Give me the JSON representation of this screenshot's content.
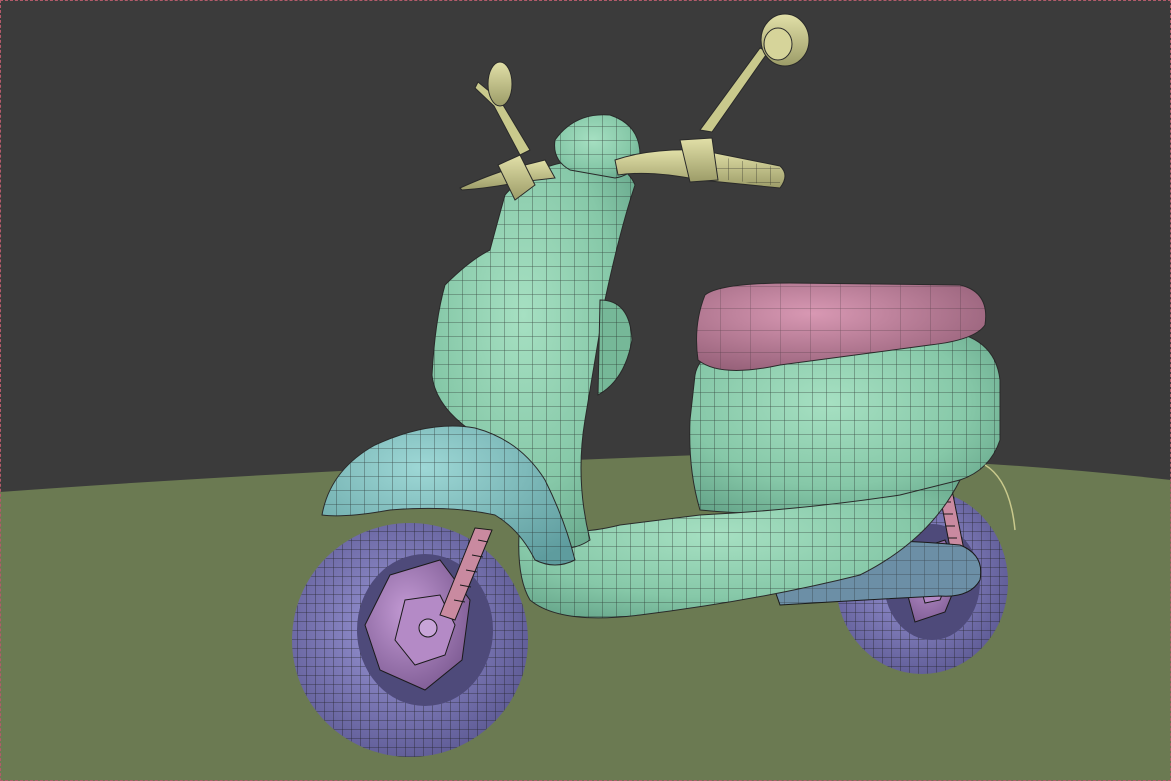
{
  "viewport": {
    "label": "",
    "colors": {
      "background": "#3b3b3b",
      "ground": "#6b7a52",
      "body_mesh": "#8fd1b0",
      "body_shadow": "#5f9e84",
      "fender_mesh": "#7fc0bf",
      "seat_mesh": "#c9849f",
      "seat_shadow": "#8e5a72",
      "tire_mesh": "#8a86c9",
      "rim_mesh": "#a07bb3",
      "handlebar_mesh": "#c9c98c",
      "fork_mesh": "#c98aa0",
      "wire": "#1a1a1a",
      "border": "#b35a6a"
    },
    "objects": [
      {
        "name": "scooter-body",
        "material": "body_mesh"
      },
      {
        "name": "front-fender",
        "material": "fender_mesh"
      },
      {
        "name": "seat",
        "material": "seat_mesh"
      },
      {
        "name": "front-wheel",
        "material": "tire_mesh"
      },
      {
        "name": "rear-wheel",
        "material": "tire_mesh"
      },
      {
        "name": "handlebar",
        "material": "handlebar_mesh"
      },
      {
        "name": "mirror-left",
        "material": "handlebar_mesh"
      },
      {
        "name": "mirror-right",
        "material": "handlebar_mesh"
      },
      {
        "name": "exhaust",
        "material": "body_mesh"
      }
    ]
  }
}
